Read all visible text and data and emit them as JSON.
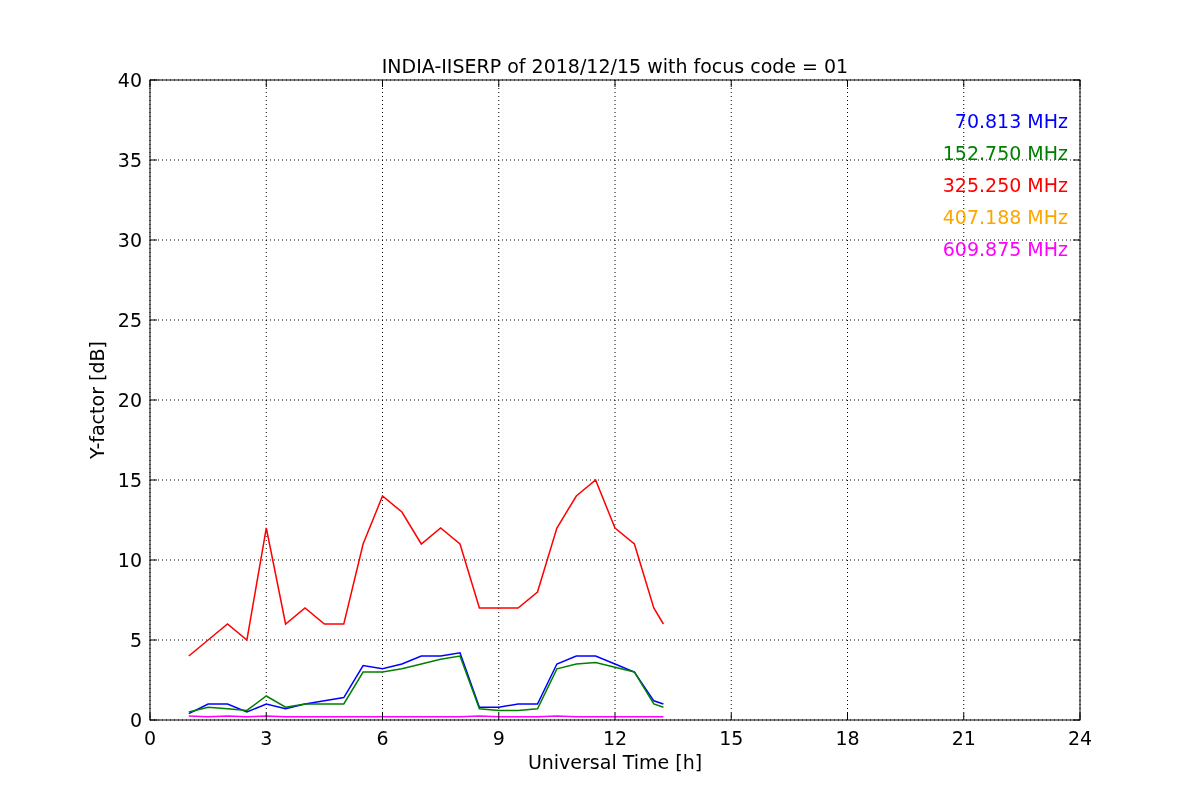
{
  "chart_data": {
    "type": "line",
    "title": "INDIA-IISERP of 2018/12/15 with focus code = 01",
    "xlabel": "Universal Time [h]",
    "ylabel": "Y-factor [dB]",
    "grid": true,
    "xlim": [
      0,
      24
    ],
    "ylim": [
      0,
      40
    ],
    "xticks": [
      0,
      3,
      6,
      9,
      12,
      15,
      18,
      21,
      24
    ],
    "yticks": [
      0,
      5,
      10,
      15,
      20,
      25,
      30,
      35,
      40
    ],
    "x": [
      1,
      1.5,
      2,
      2.5,
      3,
      3.5,
      4,
      4.5,
      5,
      5.5,
      6,
      6.5,
      7,
      7.5,
      8,
      8.5,
      9,
      9.5,
      10,
      10.5,
      11,
      11.5,
      12,
      12.5,
      13,
      13.25
    ],
    "series": [
      {
        "name": "70.813 MHz",
        "color": "#0000ff",
        "values": [
          0.4,
          1,
          1,
          0.5,
          1,
          0.7,
          1,
          1.2,
          1.4,
          3.4,
          3.2,
          3.5,
          4,
          4,
          4.2,
          0.8,
          0.8,
          1,
          1,
          3.5,
          4,
          4,
          3.5,
          3,
          1.2,
          1
        ]
      },
      {
        "name": "152.750 MHz",
        "color": "#008000",
        "values": [
          0.5,
          0.8,
          0.7,
          0.6,
          1.5,
          0.8,
          1,
          1,
          1,
          3,
          3,
          3.2,
          3.5,
          3.8,
          4,
          0.7,
          0.6,
          0.6,
          0.7,
          3.2,
          3.5,
          3.6,
          3.3,
          3,
          1,
          0.8
        ]
      },
      {
        "name": "325.250 MHz",
        "color": "#ff0000",
        "values": [
          4,
          5,
          6,
          5,
          12,
          6,
          7,
          6,
          6,
          11,
          14,
          13,
          11,
          12,
          11,
          7,
          7,
          7,
          8,
          12,
          14,
          15,
          12,
          11,
          7,
          6
        ]
      },
      {
        "name": "407.188 MHz",
        "color": "#ffa500",
        "values": [
          null,
          null,
          null,
          null,
          null,
          null,
          null,
          null,
          null,
          null,
          null,
          null,
          null,
          null,
          null,
          null,
          null,
          null,
          null,
          null,
          null,
          null,
          null,
          null,
          null,
          null
        ]
      },
      {
        "name": "609.875 MHz",
        "color": "#ff00ff",
        "values": [
          0.25,
          0.2,
          0.25,
          0.2,
          0.25,
          0.2,
          0.2,
          0.2,
          0.2,
          0.2,
          0.2,
          0.2,
          0.2,
          0.2,
          0.2,
          0.25,
          0.2,
          0.2,
          0.2,
          0.25,
          0.2,
          0.2,
          0.2,
          0.2,
          0.2,
          0.2
        ]
      }
    ]
  }
}
